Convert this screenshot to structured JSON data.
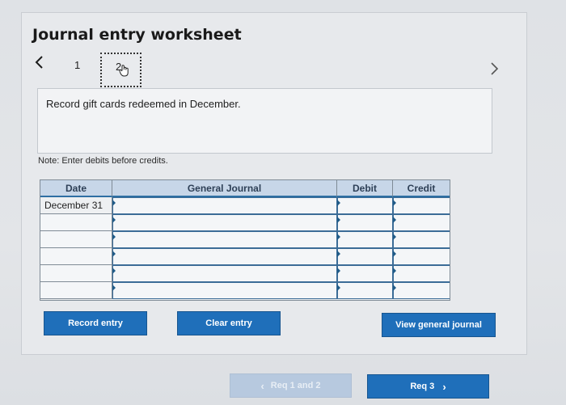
{
  "worksheet": {
    "title": "Journal entry worksheet",
    "steps": [
      {
        "label": "1"
      },
      {
        "label": "2"
      }
    ],
    "prev_icon": "chevron-left-icon",
    "next_icon": "chevron-right-icon",
    "instruction": "Record gift cards redeemed in December.",
    "note": "Note: Enter debits before credits."
  },
  "journal": {
    "headers": {
      "date": "Date",
      "general_journal": "General Journal",
      "debit": "Debit",
      "credit": "Credit"
    },
    "rows": [
      {
        "date": "December 31",
        "account": "",
        "debit": "",
        "credit": ""
      },
      {
        "date": "",
        "account": "",
        "debit": "",
        "credit": ""
      },
      {
        "date": "",
        "account": "",
        "debit": "",
        "credit": ""
      },
      {
        "date": "",
        "account": "",
        "debit": "",
        "credit": ""
      },
      {
        "date": "",
        "account": "",
        "debit": "",
        "credit": ""
      },
      {
        "date": "",
        "account": "",
        "debit": "",
        "credit": ""
      }
    ]
  },
  "buttons": {
    "record_entry": "Record entry",
    "clear_entry": "Clear entry",
    "view_general_journal": "View general journal"
  },
  "pager": {
    "prev_label": "Req 1 and 2",
    "next_label": "Req 3"
  },
  "colors": {
    "accent": "#1f6fba",
    "header_fill": "#c7d6e8",
    "disabled_button": "#b7c9df"
  }
}
